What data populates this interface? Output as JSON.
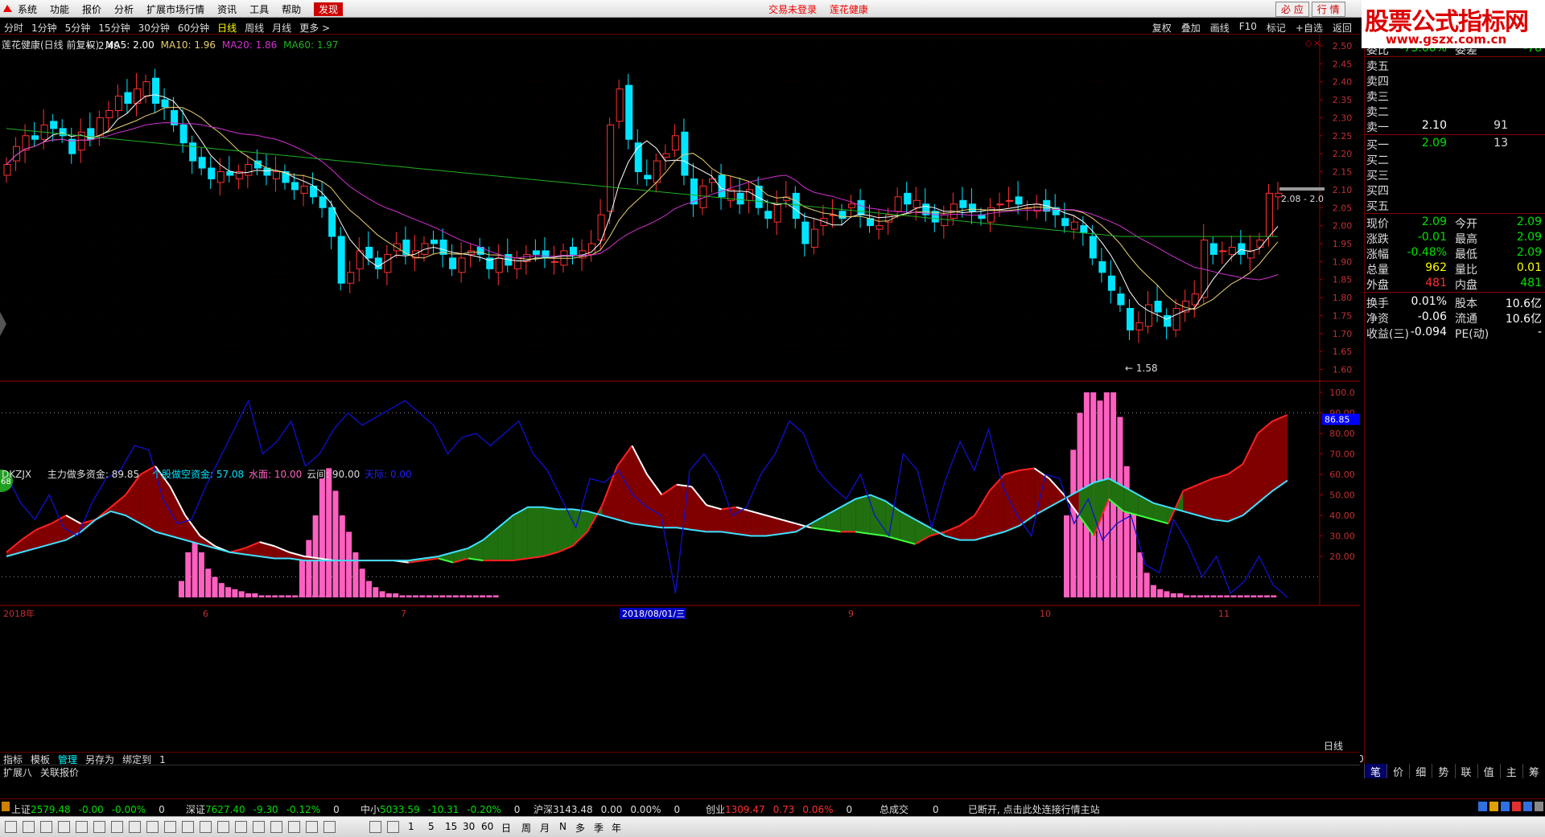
{
  "menubar": {
    "items": [
      "系统",
      "功能",
      "报价",
      "分析",
      "扩展市场行情",
      "资讯",
      "工具",
      "帮助",
      "发现"
    ],
    "status": "交易未登录",
    "stock_name": "莲花健康",
    "right_tabs": [
      "必 应",
      "行 情"
    ]
  },
  "brand": {
    "title": "股票公式指标网",
    "url": "www.gszx.com.cn"
  },
  "periodbar": {
    "periods": [
      "分时",
      "1分钟",
      "5分钟",
      "15分钟",
      "30分钟",
      "60分钟",
      "日线",
      "周线",
      "月线",
      "更多 >"
    ],
    "active": "日线",
    "tools": [
      "复权",
      "叠加",
      "画线",
      "F10",
      "标记",
      "+自选",
      "返回"
    ]
  },
  "main_info": {
    "title": "莲花健康(日线 前复权)",
    "ma5": "MA5: 2.00",
    "ma10": "MA10: 1.96",
    "ma20": "MA20: 1.86",
    "ma60": "MA60: 1.97",
    "high_label": "2.49",
    "low_label": "1.58",
    "last_label": "2.08 - 2.0"
  },
  "sub_info": {
    "name": "DKZJX",
    "main_fund": "主力做多资金: 89.85",
    "retail_fund": "个股做空资金: 57.08",
    "water": "水面: 10.00",
    "cloud": "云间: 90.00",
    "sky": "天际: 0.00",
    "cur_value": "86.85"
  },
  "colors": {
    "up": "#ff3030",
    "down": "#00e5ff",
    "ma5": "#ffffff",
    "ma10": "#e8d070",
    "ma20": "#d030d0",
    "ma60": "#20b020",
    "bar_pink": "#ff60c0",
    "line_blue": "#1010d0"
  },
  "chart_data": [
    {
      "type": "candlestick",
      "title": "莲花健康(日线 前复权)",
      "y_ticks": [
        "2.50",
        "2.45",
        "2.40",
        "2.35",
        "2.30",
        "2.25",
        "2.20",
        "2.15",
        "2.10",
        "2.05",
        "2.00",
        "1.95",
        "1.90",
        "1.85",
        "1.80",
        "1.75",
        "1.70",
        "1.65",
        "1.60"
      ],
      "ylim": [
        1.57,
        2.52
      ],
      "close": [
        2.17,
        2.22,
        2.25,
        2.24,
        2.28,
        2.27,
        2.25,
        2.2,
        2.26,
        2.24,
        2.3,
        2.32,
        2.36,
        2.34,
        2.38,
        2.4,
        2.34,
        2.33,
        2.28,
        2.23,
        2.18,
        2.16,
        2.13,
        2.15,
        2.14,
        2.15,
        2.17,
        2.16,
        2.14,
        2.15,
        2.12,
        2.1,
        2.11,
        2.08,
        2.05,
        1.97,
        1.84,
        1.87,
        1.93,
        1.91,
        1.88,
        1.92,
        1.95,
        1.92,
        1.93,
        1.95,
        1.95,
        1.92,
        1.88,
        1.91,
        1.93,
        1.92,
        1.88,
        1.91,
        1.89,
        1.91,
        1.92,
        1.92,
        1.91,
        1.9,
        1.93,
        1.92,
        1.93,
        1.95,
        2.03,
        2.28,
        2.38,
        2.24,
        2.15,
        2.13,
        2.18,
        2.2,
        2.25,
        2.14,
        2.06,
        2.11,
        2.13,
        2.08,
        2.1,
        2.06,
        2.1,
        2.05,
        2.02,
        2.06,
        2.08,
        2.02,
        1.95,
        1.99,
        2.02,
        2.03,
        2.02,
        2.06,
        2.03,
        2.0,
        2.0,
        2.03,
        2.08,
        2.06,
        2.07,
        2.03,
        2.01,
        2.03,
        2.06,
        2.05,
        2.04,
        2.02,
        2.05,
        2.06,
        2.07,
        2.06,
        2.05,
        2.06,
        2.04,
        2.03,
        2.0,
        2.01,
        1.98,
        1.91,
        1.87,
        1.82,
        1.78,
        1.71,
        1.73,
        1.78,
        1.76,
        1.72,
        1.77,
        1.79,
        1.81,
        1.96,
        1.92,
        1.93,
        1.94,
        1.92,
        1.93,
        1.96,
        2.09,
        2.09
      ],
      "open": [
        2.14,
        2.18,
        2.21,
        2.25,
        2.24,
        2.29,
        2.27,
        2.24,
        2.21,
        2.27,
        2.25,
        2.3,
        2.32,
        2.37,
        2.34,
        2.36,
        2.41,
        2.35,
        2.32,
        2.28,
        2.23,
        2.19,
        2.16,
        2.12,
        2.15,
        2.13,
        2.14,
        2.18,
        2.16,
        2.13,
        2.15,
        2.12,
        2.09,
        2.11,
        2.08,
        2.05,
        1.97,
        1.84,
        1.88,
        1.94,
        1.91,
        1.87,
        1.93,
        1.96,
        1.91,
        1.92,
        1.96,
        1.96,
        1.91,
        1.87,
        1.92,
        1.94,
        1.91,
        1.87,
        1.92,
        1.88,
        1.9,
        1.93,
        1.93,
        1.9,
        1.89,
        1.94,
        1.91,
        1.92,
        1.96,
        2.04,
        2.29,
        2.39,
        2.23,
        2.14,
        2.12,
        2.19,
        2.21,
        2.26,
        2.13,
        2.05,
        2.12,
        2.14,
        2.07,
        2.09,
        2.07,
        2.11,
        2.04,
        2.01,
        2.07,
        2.09,
        2.01,
        1.94,
        2.0,
        2.03,
        2.04,
        2.05,
        2.07,
        2.02,
        1.99,
        2.01,
        2.04,
        2.09,
        2.05,
        2.06,
        2.04,
        2.0,
        2.02,
        2.07,
        2.06,
        2.03,
        2.01,
        2.06,
        2.07,
        2.08,
        2.05,
        2.04,
        2.07,
        2.05,
        2.02,
        1.99,
        2.0,
        1.97,
        1.9,
        1.86,
        1.81,
        1.77,
        1.71,
        1.72,
        1.79,
        1.75,
        1.71,
        1.76,
        1.78,
        1.8,
        1.95,
        1.93,
        1.92,
        1.95,
        1.91,
        1.94,
        1.97,
        2.08
      ]
    },
    {
      "type": "bar+line",
      "name": "DKZJX",
      "y_ticks": [
        "100.0",
        "90.00",
        "80.00",
        "70.00",
        "60.00",
        "50.00",
        "40.00",
        "30.00",
        "20.00"
      ],
      "ylim": [
        0,
        100
      ],
      "series": [
        {
          "name": "主力做多资金",
          "values": [
            22,
            28,
            33,
            36,
            40,
            36,
            38,
            44,
            50,
            60,
            64,
            54,
            40,
            30,
            25,
            22,
            24,
            27,
            25,
            22,
            20,
            19,
            18,
            18,
            18,
            18,
            18,
            17,
            18,
            19,
            17,
            19,
            18,
            18,
            18,
            19,
            20,
            22,
            25,
            32,
            45,
            64,
            74,
            60,
            50,
            55,
            54,
            45,
            43,
            44,
            42,
            40,
            38,
            36,
            34,
            33,
            32,
            32,
            31,
            30,
            28,
            26,
            30,
            32,
            35,
            40,
            52,
            60,
            62,
            63,
            58,
            50,
            40,
            30,
            48,
            42,
            40,
            38,
            36,
            52,
            55,
            58,
            60,
            65,
            80,
            86,
            89
          ]
        },
        {
          "name": "个股做空资金",
          "values": [
            20,
            22,
            24,
            26,
            28,
            32,
            38,
            42,
            40,
            36,
            32,
            30,
            28,
            26,
            24,
            22,
            21,
            20,
            19,
            19,
            18,
            18,
            18,
            18,
            18,
            18,
            18,
            18,
            19,
            20,
            22,
            24,
            28,
            34,
            40,
            44,
            44,
            43,
            43,
            42,
            40,
            38,
            36,
            35,
            34,
            34,
            33,
            32,
            32,
            31,
            30,
            30,
            31,
            32,
            36,
            40,
            44,
            48,
            50,
            47,
            42,
            38,
            34,
            30,
            28,
            28,
            30,
            32,
            35,
            40,
            44,
            48,
            52,
            56,
            58,
            54,
            50,
            46,
            44,
            42,
            40,
            38,
            37,
            40,
            46,
            52,
            57
          ]
        },
        {
          "name": "blue",
          "values": [
            60,
            46,
            38,
            50,
            34,
            30,
            46,
            58,
            62,
            74,
            72,
            48,
            36,
            38,
            54,
            68,
            82,
            96,
            70,
            76,
            86,
            64,
            70,
            82,
            90,
            84,
            88,
            92,
            96,
            90,
            84,
            70,
            78,
            80,
            74,
            80,
            86,
            70,
            62,
            48,
            34,
            58,
            56,
            62,
            50,
            44,
            40,
            2,
            62,
            70,
            60,
            40,
            44,
            60,
            70,
            86,
            80,
            62,
            54,
            48,
            60,
            40,
            30,
            70,
            62,
            34,
            58,
            76,
            62,
            82,
            54,
            40,
            30,
            60,
            58,
            36,
            48,
            28,
            36,
            40,
            16,
            12,
            38,
            26,
            10,
            20,
            2,
            8,
            20,
            6,
            0
          ]
        },
        {
          "name": "pink",
          "values": [
            0,
            0,
            0,
            0,
            0,
            0,
            0,
            0,
            0,
            0,
            0,
            0,
            0,
            0,
            0,
            0,
            0,
            0,
            0,
            0,
            0,
            0,
            0,
            0,
            0,
            0,
            0,
            0,
            0,
            0,
            0,
            0,
            0,
            0,
            0,
            0,
            0,
            0,
            0,
            0,
            0,
            0,
            0,
            0,
            0,
            0,
            0,
            0,
            0,
            0,
            0,
            0,
            0,
            0,
            0,
            0,
            0,
            0,
            0,
            0,
            0,
            0,
            0,
            0,
            0,
            0,
            0,
            0,
            0,
            0,
            0,
            0,
            0,
            0,
            0,
            0,
            0,
            0,
            0,
            0,
            0,
            0,
            0,
            0,
            0,
            0,
            0
          ]
        }
      ],
      "x_ticks": [
        "2018年",
        "6",
        "7",
        "2018/08/01/三",
        "9",
        "10",
        "11"
      ]
    }
  ],
  "quote": {
    "top": {
      "l": "委比",
      "v": "-75.00%",
      "l2": "委差",
      "r2": "-78"
    },
    "sell": [
      {
        "l": "卖五",
        "price": "",
        "vol": ""
      },
      {
        "l": "卖四",
        "price": "",
        "vol": ""
      },
      {
        "l": "卖三",
        "price": "",
        "vol": ""
      },
      {
        "l": "卖二",
        "price": "",
        "vol": ""
      },
      {
        "l": "卖一",
        "price": "2.10",
        "vol": "91"
      }
    ],
    "buy": [
      {
        "l": "买一",
        "price": "2.09",
        "vol": "13"
      },
      {
        "l": "买二",
        "price": "",
        "vol": ""
      },
      {
        "l": "买三",
        "price": "",
        "vol": ""
      },
      {
        "l": "买四",
        "price": "",
        "vol": ""
      },
      {
        "l": "买五",
        "price": "",
        "vol": ""
      }
    ],
    "stats": [
      {
        "l": "现价",
        "v": "2.09",
        "vc": "green",
        "l2": "今开",
        "r2": "2.09",
        "rc": "green"
      },
      {
        "l": "涨跌",
        "v": "-0.01",
        "vc": "green",
        "l2": "最高",
        "r2": "2.09",
        "rc": "green"
      },
      {
        "l": "涨幅",
        "v": "-0.48%",
        "vc": "green",
        "l2": "最低",
        "r2": "2.09",
        "rc": "green"
      },
      {
        "l": "总量",
        "v": "962",
        "vc": "yellow",
        "l2": "量比",
        "r2": "0.01",
        "rc": "yellow"
      },
      {
        "l": "外盘",
        "v": "481",
        "vc": "red",
        "l2": "内盘",
        "r2": "481",
        "rc": "green"
      },
      {
        "l": "换手",
        "v": "0.01%",
        "vc": "white",
        "l2": "股本",
        "r2": "10.6亿",
        "rc": "white"
      },
      {
        "l": "净资",
        "v": "-0.06",
        "vc": "white",
        "l2": "流通",
        "r2": "10.6亿",
        "rc": "white"
      },
      {
        "l": "收益(三)",
        "v": "-0.094",
        "vc": "white",
        "l2": "PE(动)",
        "r2": "-",
        "rc": "white"
      }
    ],
    "tabs": [
      "笔",
      "价",
      "细",
      "势",
      "联",
      "值",
      "主",
      "筹"
    ]
  },
  "bottom": {
    "tabs": [
      "指标",
      "模板",
      "管理",
      "另存为",
      "绑定到",
      "1"
    ],
    "ext": [
      "扩展八",
      "关联报价"
    ],
    "day_label": "日线",
    "zoom": [
      "+",
      "-",
      "0"
    ],
    "indices": [
      {
        "name": "上证",
        "value": "2579.48",
        "chg": "-0.00",
        "pct": "-0.00%",
        "vol": "0",
        "x": 14
      },
      {
        "name": "深证",
        "value": "7627.40",
        "chg": "-9.30",
        "pct": "-0.12%",
        "vol": "0",
        "x": 231
      },
      {
        "name": "中小",
        "value": "5033.59",
        "chg": "-10.31",
        "pct": "-0.20%",
        "vol": "0",
        "x": 448
      },
      {
        "name": "沪深",
        "value": "3143.48",
        "chg": "0.00",
        "pct": "0.00%",
        "vol": "0",
        "x": 663
      },
      {
        "name": "创业",
        "value": "1309.47",
        "chg": "0.73",
        "pct": "0.06%",
        "vol": "0",
        "x": 877
      }
    ],
    "total_label": "总成交",
    "total_value": "0",
    "conn_status": "已断开, 点击此处连接行情主站",
    "toolbar_text": [
      "1",
      "5",
      "15",
      "30",
      "60",
      "日",
      "周",
      "月",
      "N",
      "多",
      "季",
      "年"
    ]
  }
}
